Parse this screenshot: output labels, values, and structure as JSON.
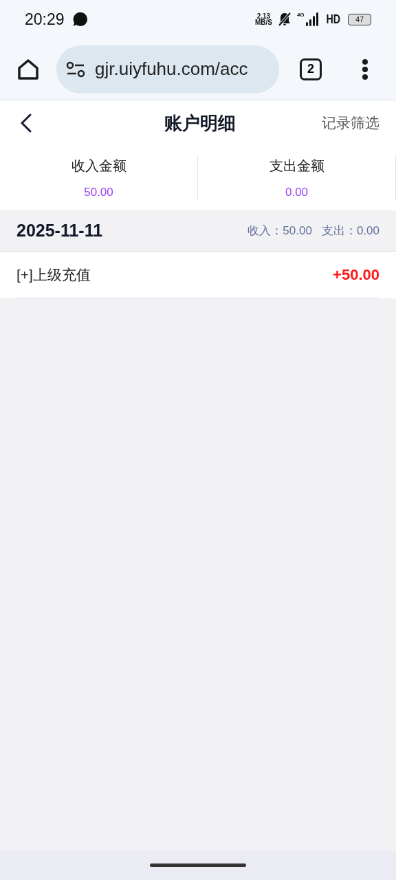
{
  "status_bar": {
    "time": "20:29",
    "speed_value": "2.13",
    "speed_unit": "MB/S",
    "network": "4G",
    "hd": "HD",
    "battery": "47"
  },
  "browser": {
    "url": "gjr.uiyfuhu.com/acc",
    "tab_count": "2"
  },
  "header": {
    "title": "账户明细",
    "filter": "记录筛选"
  },
  "summary": [
    {
      "label": "收入金额",
      "value": "50.00"
    },
    {
      "label": "支出金额",
      "value": "0.00"
    }
  ],
  "groups": [
    {
      "date": "2025-11-11",
      "income": "收入：50.00",
      "expense": "支出：0.00",
      "records": [
        {
          "title": "[+]上级充值",
          "amount": "+50.00",
          "kind": "income"
        }
      ]
    }
  ]
}
